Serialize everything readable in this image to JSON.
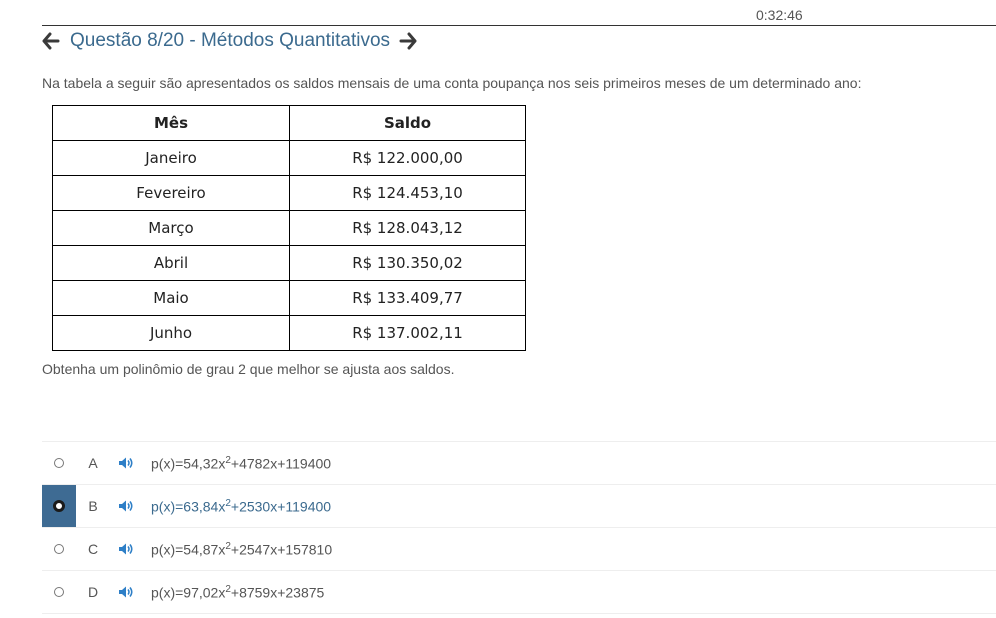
{
  "timer": "0:32:46",
  "header": {
    "title": "Questão 8/20 - Métodos Quantitativos"
  },
  "prompt": "Na tabela a seguir são apresentados os saldos mensais de uma conta poupança nos seis primeiros meses de um determinado ano:",
  "table": {
    "headers": [
      "Mês",
      "Saldo"
    ],
    "rows": [
      [
        "Janeiro",
        "R$ 122.000,00"
      ],
      [
        "Fevereiro",
        "R$ 124.453,10"
      ],
      [
        "Março",
        "R$ 128.043,12"
      ],
      [
        "Abril",
        "R$ 130.350,02"
      ],
      [
        "Maio",
        "R$ 133.409,77"
      ],
      [
        "Junho",
        "R$ 137.002,11"
      ]
    ]
  },
  "question": "Obtenha um polinômio de grau 2 que melhor se ajusta aos saldos.",
  "options": [
    {
      "letter": "A",
      "pre": "p(x)=54,32x",
      "exp": "2",
      "post": "+4782x+119400",
      "selected": false
    },
    {
      "letter": "B",
      "pre": "p(x)=63,84x",
      "exp": "2",
      "post": "+2530x+119400",
      "selected": true
    },
    {
      "letter": "C",
      "pre": "p(x)=54,87x",
      "exp": "2",
      "post": "+2547x+157810",
      "selected": false
    },
    {
      "letter": "D",
      "pre": "p(x)=97,02x",
      "exp": "2",
      "post": "+8759x+23875",
      "selected": false
    }
  ],
  "colors": {
    "accent": "#3e6b93",
    "link": "#3b6a8e",
    "speaker": "#2e7fc7"
  },
  "icons": {
    "prev": "arrow-left-icon",
    "next": "arrow-right-icon",
    "audio": "speaker-icon"
  }
}
